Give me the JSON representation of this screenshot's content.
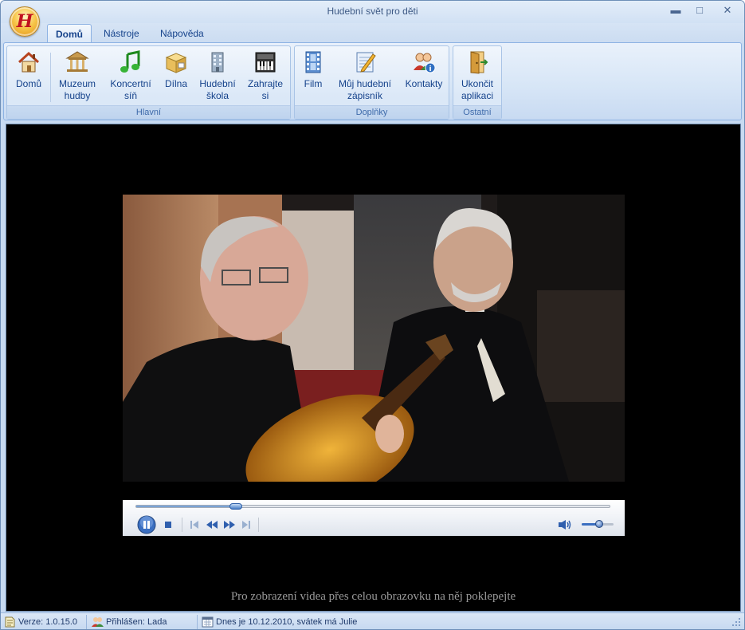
{
  "window": {
    "title": "Hudební svět pro děti",
    "orb_letter": "H",
    "controls": {
      "minimize": "▬",
      "maximize": "□",
      "close": "✕"
    }
  },
  "tabs": [
    {
      "label": "Domů",
      "active": true
    },
    {
      "label": "Nástroje",
      "active": false
    },
    {
      "label": "Nápověda",
      "active": false
    }
  ],
  "ribbon": {
    "groups": [
      {
        "label": "Hlavní",
        "buttons": [
          {
            "label": "Domů",
            "icon": "house-icon"
          },
          {
            "label": "Muzeum\nhudby",
            "icon": "museum-icon"
          },
          {
            "label": "Koncertní\nsíň",
            "icon": "music-note-icon"
          },
          {
            "label": "Dílna",
            "icon": "workshop-box-icon"
          },
          {
            "label": "Hudební\nškola",
            "icon": "school-building-icon"
          },
          {
            "label": "Zahrajte\nsi",
            "icon": "keyboard-synth-icon"
          }
        ]
      },
      {
        "label": "Doplňky",
        "buttons": [
          {
            "label": "Film",
            "icon": "film-strip-icon"
          },
          {
            "label": "Můj hudební\nzápisník",
            "icon": "notebook-pen-icon"
          },
          {
            "label": "Kontakty",
            "icon": "contacts-people-icon"
          }
        ]
      },
      {
        "label": "Ostatní",
        "buttons": [
          {
            "label": "Ukončit\naplikaci",
            "icon": "exit-door-icon"
          }
        ]
      }
    ]
  },
  "player": {
    "hint": "Pro zobrazení videa přes celou obrazovku na něj poklepejte",
    "progress_fraction": 0.21,
    "volume_fraction": 0.55,
    "state": "playing"
  },
  "statusbar": {
    "version": "Verze: 1.0.15.0",
    "user": "Přihlášen: Lada",
    "date": "Dnes je 10.12.2010, svátek má Julie"
  },
  "colors": {
    "ribbon_text": "#15428b",
    "video_bg": "#000000",
    "accent_blue": "#4a7fc7"
  }
}
